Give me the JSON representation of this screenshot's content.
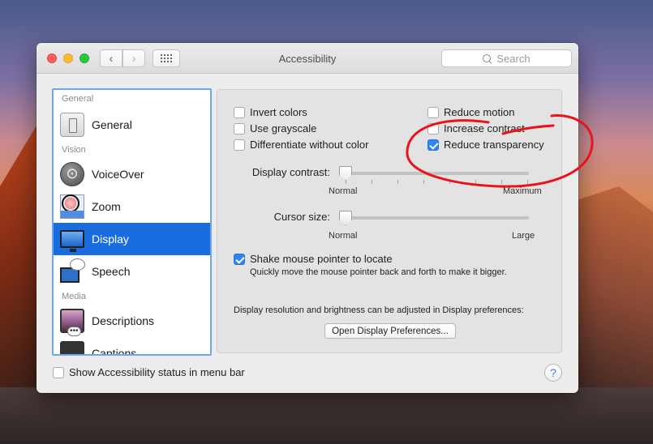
{
  "window": {
    "title": "Accessibility"
  },
  "search": {
    "placeholder": "Search"
  },
  "sidebar": {
    "sections": [
      {
        "header": "General",
        "items": [
          {
            "label": "General",
            "icon": "general-icon"
          }
        ]
      },
      {
        "header": "Vision",
        "items": [
          {
            "label": "VoiceOver",
            "icon": "voiceover-icon"
          },
          {
            "label": "Zoom",
            "icon": "zoom-icon"
          },
          {
            "label": "Display",
            "icon": "display-icon",
            "selected": true
          },
          {
            "label": "Speech",
            "icon": "speech-icon"
          }
        ]
      },
      {
        "header": "Media",
        "items": [
          {
            "label": "Descriptions",
            "icon": "descriptions-icon"
          },
          {
            "label": "Captions",
            "icon": "captions-icon"
          }
        ]
      }
    ]
  },
  "display": {
    "invert_colors": {
      "label": "Invert colors",
      "checked": false
    },
    "use_grayscale": {
      "label": "Use grayscale",
      "checked": false
    },
    "differentiate": {
      "label": "Differentiate without color",
      "checked": false
    },
    "reduce_motion": {
      "label": "Reduce motion",
      "checked": false
    },
    "increase_contrast": {
      "label": "Increase contrast",
      "checked": false
    },
    "reduce_transparency": {
      "label": "Reduce transparency",
      "checked": true
    },
    "contrast_slider": {
      "label": "Display contrast:",
      "min_label": "Normal",
      "max_label": "Maximum",
      "value": 0
    },
    "cursor_slider": {
      "label": "Cursor size:",
      "min_label": "Normal",
      "max_label": "Large",
      "value": 0
    },
    "shake": {
      "label": "Shake mouse pointer to locate",
      "checked": true,
      "description": "Quickly move the mouse pointer back and forth to make it bigger."
    },
    "resolution_note": "Display resolution and brightness can be adjusted in Display preferences:",
    "open_prefs_button": "Open Display Preferences..."
  },
  "footer": {
    "show_status": {
      "label": "Show Accessibility status in menu bar",
      "checked": false
    },
    "help_label": "?"
  },
  "colors": {
    "accent": "#1a6dde",
    "annotation": "#e8141c"
  }
}
